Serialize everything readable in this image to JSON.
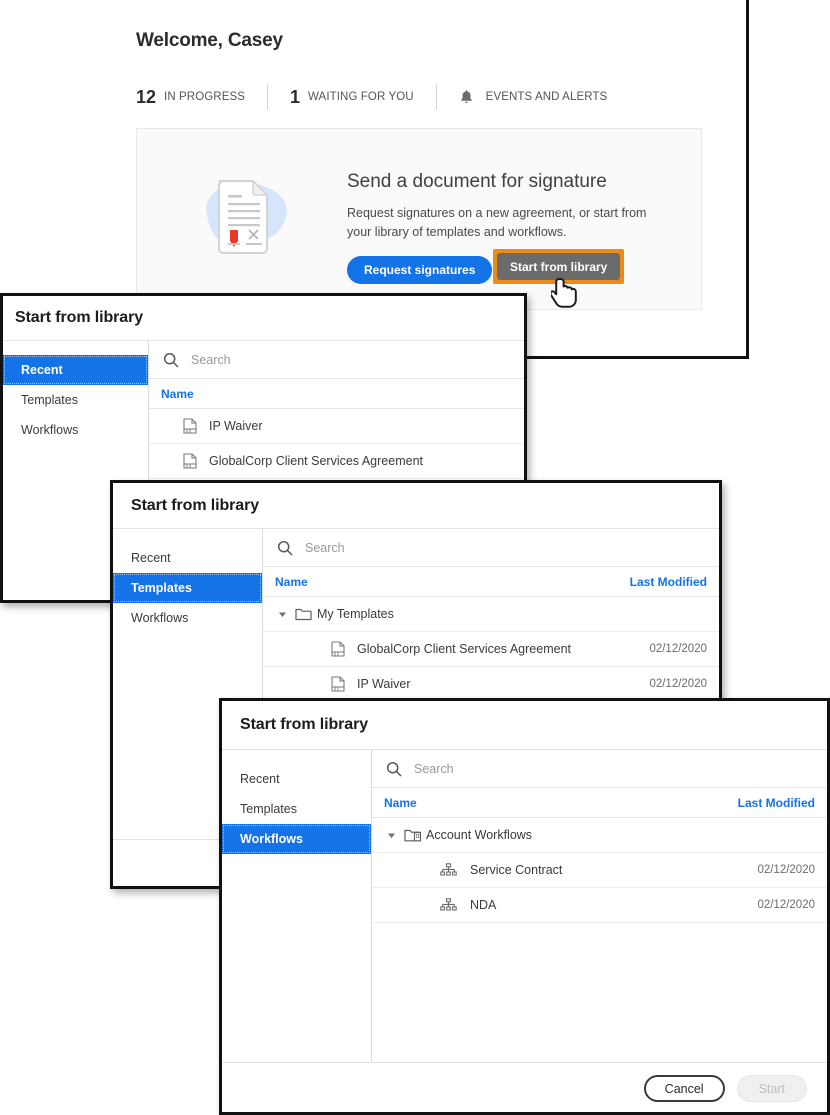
{
  "app": {
    "welcome_title": "Welcome, Casey",
    "stats": [
      {
        "number": "12",
        "label": "IN PROGRESS",
        "icon": ""
      },
      {
        "number": "1",
        "label": "WAITING FOR YOU",
        "icon": ""
      },
      {
        "number": "",
        "label": "EVENTS AND ALERTS",
        "icon": "bell-icon"
      }
    ],
    "promo": {
      "title": "Send a document for signature",
      "subtitle": "Request signatures on a new agreement, or start from your library of templates and workflows.",
      "primary_button": "Request signatures",
      "secondary_button": "Start from library",
      "primary_color": "#1473e6",
      "highlight_color": "#eb8b19",
      "secondary_color": "#6b6b6b"
    }
  },
  "dialog_recent": {
    "title": "Start from library",
    "sidebar": [
      {
        "label": "Recent",
        "selected": true
      },
      {
        "label": "Templates",
        "selected": false
      },
      {
        "label": "Workflows",
        "selected": false
      }
    ],
    "search_placeholder": "Search",
    "search_value": "",
    "columns": {
      "name": "Name",
      "last_modified": ""
    },
    "rows": [
      {
        "label": "IP Waiver",
        "date": "",
        "icon": "document-icon",
        "indent": 1
      },
      {
        "label": "GlobalCorp Client Services Agreement",
        "date": "",
        "icon": "document-icon",
        "indent": 1
      }
    ]
  },
  "dialog_templates": {
    "title": "Start from library",
    "sidebar": [
      {
        "label": "Recent",
        "selected": false
      },
      {
        "label": "Templates",
        "selected": true
      },
      {
        "label": "Workflows",
        "selected": false
      }
    ],
    "search_placeholder": "Search",
    "search_value": "",
    "columns": {
      "name": "Name",
      "last_modified": "Last Modified"
    },
    "rows": [
      {
        "label": "My Templates",
        "date": "",
        "icon": "folder-icon",
        "indent": 0
      },
      {
        "label": "GlobalCorp Client Services Agreement",
        "date": "02/12/2020",
        "icon": "document-icon",
        "indent": 1
      },
      {
        "label": "IP Waiver",
        "date": "02/12/2020",
        "icon": "document-icon",
        "indent": 1
      }
    ],
    "footer": {
      "cancel": "Cancel",
      "start": "Start"
    }
  },
  "dialog_workflows": {
    "title": "Start from library",
    "sidebar": [
      {
        "label": "Recent",
        "selected": false
      },
      {
        "label": "Templates",
        "selected": false
      },
      {
        "label": "Workflows",
        "selected": true
      }
    ],
    "search_placeholder": "Search",
    "search_value": "",
    "columns": {
      "name": "Name",
      "last_modified": "Last Modified"
    },
    "rows": [
      {
        "label": "Account Workflows",
        "date": "",
        "icon": "folder-account-icon",
        "indent": 0
      },
      {
        "label": "Service Contract",
        "date": "02/12/2020",
        "icon": "workflow-icon",
        "indent": 1
      },
      {
        "label": "NDA",
        "date": "02/12/2020",
        "icon": "workflow-icon",
        "indent": 1
      }
    ],
    "footer": {
      "cancel": "Cancel",
      "start": "Start"
    }
  }
}
